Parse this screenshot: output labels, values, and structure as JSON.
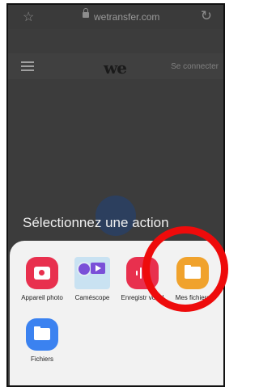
{
  "browser": {
    "domain": "wetransfer.com"
  },
  "site": {
    "logo": "we",
    "login": "Se connecter"
  },
  "sheet": {
    "title": "Sélectionnez une action",
    "apps": [
      {
        "label": "Appareil photo",
        "icon": "camera-icon"
      },
      {
        "label": "Caméscope",
        "icon": "camcorder-icon"
      },
      {
        "label": "Enregistr vocal",
        "icon": "voice-recorder-icon"
      },
      {
        "label": "Mes fichiers",
        "icon": "folder-icon"
      },
      {
        "label": "Fichiers",
        "icon": "files-icon"
      }
    ]
  },
  "colors": {
    "annotation_circle": "#ee0b0b",
    "sheet_bg": "#f2f2f2"
  }
}
